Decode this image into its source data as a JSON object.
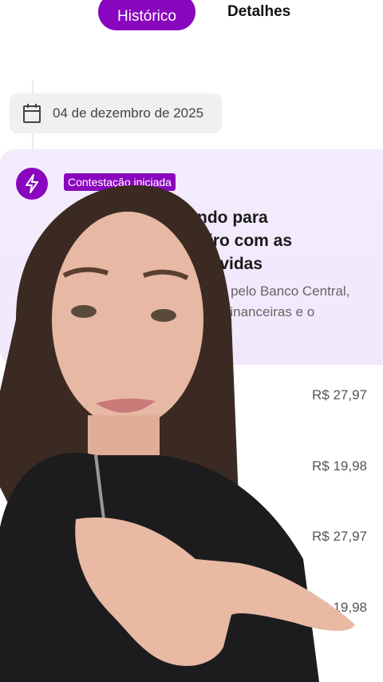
{
  "tabs": {
    "active": "Histórico",
    "inactive": "Detalhes"
  },
  "date_chip": {
    "icon": "calendar-icon",
    "date": "04 de dezembro de 2025"
  },
  "card": {
    "icon": "bolt-icon",
    "badge": "Contestação iniciada",
    "title": "alhando para dinheiro com as volvidas",
    "title_lines": [
      "alhando para",
      "dinheiro com as",
      "volvidas"
    ],
    "desc_lines": [
      "ado pelo Banco Central,",
      "ções financeiras e o"
    ]
  },
  "amounts": [
    "R$ 27,97",
    "R$ 19,98",
    "R$ 27,97",
    "R$ 19,98"
  ],
  "colors": {
    "accent": "#8a05be",
    "card_bg": "#f3ecfd"
  }
}
